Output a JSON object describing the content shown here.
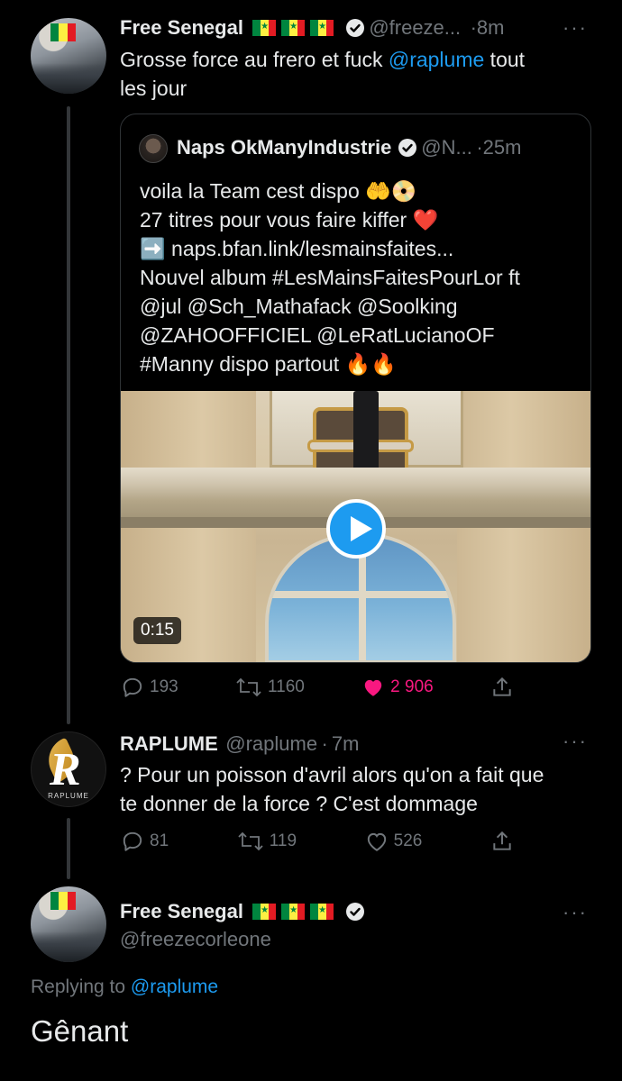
{
  "tweet1": {
    "name": "Free Senegal",
    "handle": "@freeze...",
    "separator": "·",
    "time": "8m",
    "text_before": "Grosse force au frero et fuck ",
    "mention": "@raplume",
    "text_after1": " tout",
    "text_line2": "les jour"
  },
  "quote": {
    "name": "Naps OkManyIndustrie",
    "handle": "@N...",
    "separator": "·",
    "time": "25m",
    "lines": [
      "voila la Team cest dispo 🤲📀",
      "27 titres pour vous faire kiffer ❤️",
      "➡️ naps.bfan.link/lesmainsfaites...",
      "Nouvel album #LesMainsFaitesPourLor ft",
      "@jul  @Sch_Mathafack @Soolking",
      "@ZAHOOFFICIEL  @LeRatLucianoOF",
      "#Manny dispo partout 🔥🔥"
    ],
    "video_duration": "0:15"
  },
  "tweet1_actions": {
    "replies": "193",
    "retweets": "1160",
    "likes": "2 906"
  },
  "tweet2": {
    "name": "RAPLUME",
    "handle": "@raplume",
    "separator": "·",
    "time": "7m",
    "line1": "? Pour un poisson d'avril alors qu'on a fait que",
    "line2": "te donner de la force ? C'est dommage",
    "avatar_label": "RAPLUME",
    "replies": "81",
    "retweets": "119",
    "likes": "526"
  },
  "tweet3": {
    "name": "Free Senegal",
    "handle": "@freezecorleone",
    "replying_prefix": "Replying to",
    "replying_to": "@raplume",
    "text": "Gênant"
  },
  "colors": {
    "background": "#000000",
    "accent": "#1d9bf0",
    "like": "#f91880",
    "muted": "#71767b"
  }
}
